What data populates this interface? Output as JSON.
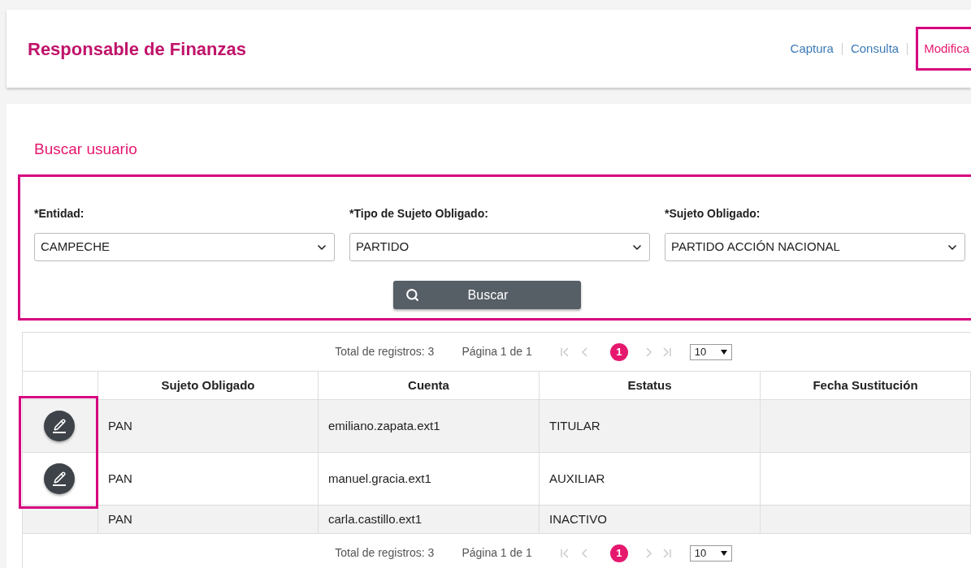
{
  "header": {
    "title": "Responsable de Finanzas",
    "nav": [
      {
        "label": "Captura",
        "selected": false
      },
      {
        "label": "Consulta",
        "selected": false
      },
      {
        "label": "Modifica",
        "selected": true
      }
    ]
  },
  "search": {
    "title": "Buscar usuario",
    "fields": [
      {
        "label": "*Entidad:",
        "value": "CAMPECHE"
      },
      {
        "label": "*Tipo de Sujeto Obligado:",
        "value": "PARTIDO"
      },
      {
        "label": "*Sujeto Obligado:",
        "value": "PARTIDO ACCIÓN NACIONAL"
      }
    ],
    "button": "Buscar"
  },
  "table": {
    "pager_top": {
      "total": "Total de registros: 3",
      "page": "Página 1 de 1",
      "pages": [
        {
          "label": "1",
          "selected": true
        }
      ],
      "page_size": "10"
    },
    "columns": [
      "Sujeto Obligado",
      "Cuenta",
      "Estatus",
      "Fecha Sustitución"
    ],
    "rows": [
      {
        "editable": true,
        "highlighted": true,
        "cells": [
          "PAN",
          "emiliano.zapata.ext1",
          "TITULAR"
        ]
      },
      {
        "editable": true,
        "highlighted": true,
        "cells": [
          "PAN",
          "manuel.gracia.ext1",
          "AUXILIAR"
        ]
      },
      {
        "editable": false,
        "highlighted": false,
        "cells": [
          "PAN",
          "carla.castillo.ext1",
          "INACTIVO"
        ]
      }
    ],
    "pager_bottom": {
      "total": "Total de registros: 3",
      "page": "Página 1 de 1",
      "pages": [
        {
          "label": "1",
          "selected": true
        }
      ],
      "page_size": "10"
    }
  }
}
